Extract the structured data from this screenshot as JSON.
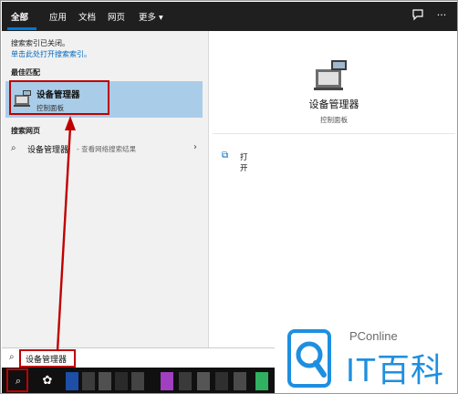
{
  "tabs": [
    {
      "label": "全部",
      "active": true
    },
    {
      "label": "应用"
    },
    {
      "label": "文档"
    },
    {
      "label": "网页"
    },
    {
      "label": "更多 ▾"
    }
  ],
  "top_icons": [
    "feedback-icon",
    "more-icon"
  ],
  "left": {
    "notice": "搜索索引已关闭。",
    "notice_link": "单击此处打开搜索索引。",
    "best_match_heading": "最佳匹配",
    "best_match": {
      "title": "设备管理器",
      "subtitle": "控制面板",
      "icon": "device-manager-icon"
    },
    "web_heading": "搜索网页",
    "web_result": {
      "term": "设备管理器",
      "desc": "- 查看网络搜索结果"
    }
  },
  "right": {
    "title": "设备管理器",
    "subtitle": "控制面板",
    "open_label": "打开"
  },
  "search": {
    "value": "设备管理器"
  },
  "annotation": {
    "color": "#c00000"
  },
  "watermark": {
    "brand_small": "PConline",
    "brand_big": "IT百科"
  },
  "colors": {
    "accent": "#0078d7",
    "selection": "#a9cde9",
    "dark": "#1f1f1f"
  }
}
